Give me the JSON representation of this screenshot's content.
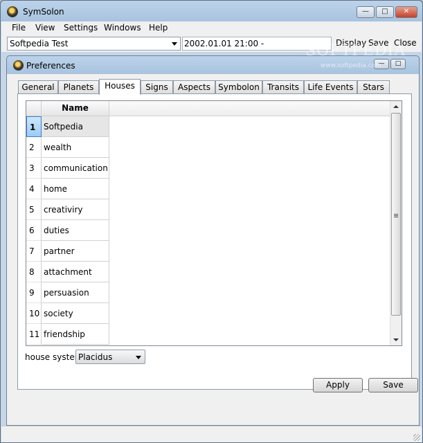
{
  "window": {
    "title": "SymSolon"
  },
  "menu": [
    "File",
    "View",
    "Settings",
    "Windows",
    "Help"
  ],
  "toolbar": {
    "chart_selector": "Softpedia Test",
    "datetime": "2002.01.01 21:00 -",
    "display_label": "Display",
    "save_label": "Save",
    "close_label": "Close"
  },
  "watermark": {
    "text": "SOFTPEDIA",
    "sub": "www.softpedia.com"
  },
  "preferences": {
    "title": "Preferences",
    "tabs": [
      "General",
      "Planets",
      "Houses",
      "Signs",
      "Aspects",
      "Symbolon",
      "Transits",
      "Life Events",
      "Stars"
    ],
    "active_tab": "Houses",
    "grid": {
      "column_header": "Name",
      "rows": [
        {
          "num": "1",
          "name": "Softpedia"
        },
        {
          "num": "2",
          "name": "wealth"
        },
        {
          "num": "3",
          "name": "communication"
        },
        {
          "num": "4",
          "name": "home"
        },
        {
          "num": "5",
          "name": "creativiry"
        },
        {
          "num": "6",
          "name": "duties"
        },
        {
          "num": "7",
          "name": "partner"
        },
        {
          "num": "8",
          "name": "attachment"
        },
        {
          "num": "9",
          "name": "persuasion"
        },
        {
          "num": "10",
          "name": "society"
        },
        {
          "num": "11",
          "name": "friendship"
        }
      ]
    },
    "house_system_label": "house system",
    "house_system_value": "Placidus",
    "apply_label": "Apply",
    "save_label": "Save"
  }
}
